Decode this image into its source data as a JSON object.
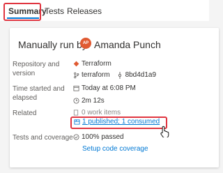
{
  "tabs": [
    {
      "label": "Summary",
      "active": true
    },
    {
      "label": "Tests"
    },
    {
      "label": "Releases"
    }
  ],
  "run": {
    "title": "Manually run by",
    "avatar_initials": "AP",
    "user": "Amanda Punch"
  },
  "details": {
    "repo_label_1": "Repository and",
    "repo_label_2": "version",
    "repo_name": "Terraform",
    "branch": "terraform",
    "commit": "8bd4d1a9",
    "time_label_1": "Time started and",
    "time_label_2": "elapsed",
    "started": "Today at 6:08 PM",
    "elapsed": "2m 12s",
    "related_label": "Related",
    "work_items": "0 work items",
    "artifacts": "1 published; 1 consumed",
    "tests_label": "Tests and coverage",
    "tests_result": "100% passed",
    "coverage_link": "Setup code coverage"
  },
  "colors": {
    "accent": "#0078d4",
    "highlight": "#e0343f",
    "avatar": "#e05a32",
    "repo_icon": "#e05a32",
    "success": "#107c10"
  }
}
